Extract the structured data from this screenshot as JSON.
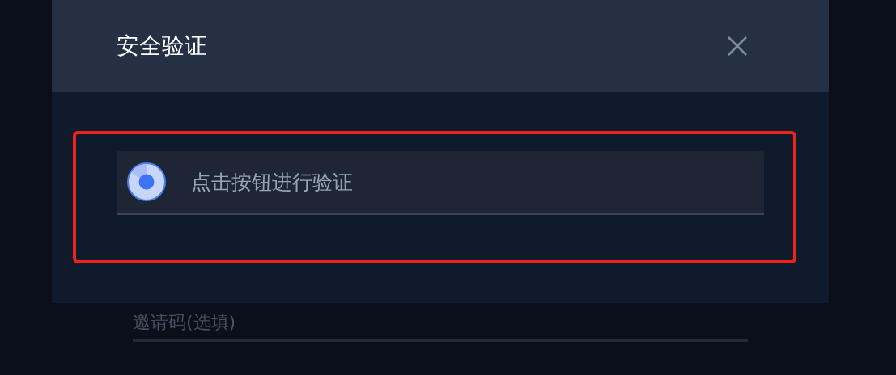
{
  "dialog": {
    "title": "安全验证",
    "verify_button": {
      "label": "点击按钮进行验证"
    }
  },
  "background_form": {
    "invite_code": {
      "placeholder": "邀请码(选填)"
    }
  }
}
